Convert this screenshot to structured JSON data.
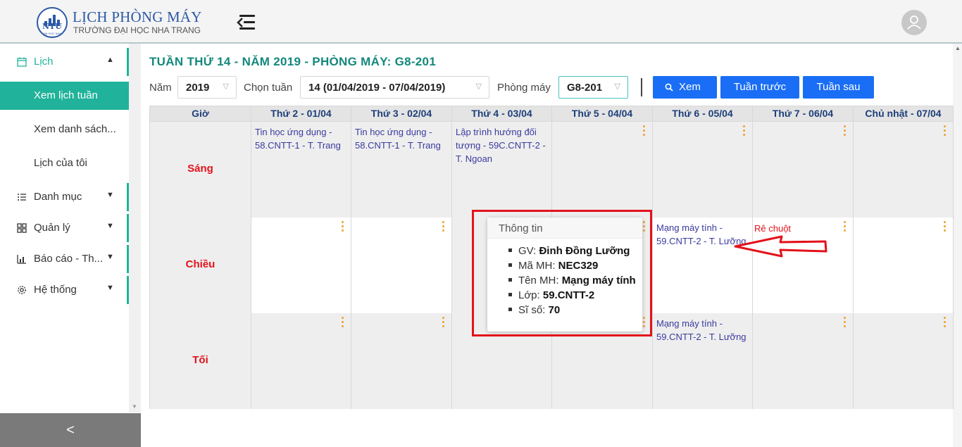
{
  "brand": {
    "title": "LỊCH PHÒNG MÁY",
    "subtitle": "TRƯỜNG ĐẠI HỌC NHA TRANG",
    "logo_text": "NTU",
    "logo_ring": "ĐẠI HỌC NHA TRANG",
    "color": "#2b59a6"
  },
  "sidebar": {
    "calendar": {
      "label": "Lịch",
      "icon": "calendar-icon",
      "chevron": "▲"
    },
    "active_item": "Xem lịch tuần",
    "sub_items": [
      "Xem danh sách...",
      "Lịch của tôi"
    ],
    "groups": [
      {
        "label": "Danh mục",
        "icon": "list-icon",
        "chevron": "▼"
      },
      {
        "label": "Quản lý",
        "icon": "grid-icon",
        "chevron": "▼"
      },
      {
        "label": "Báo cáo - Th...",
        "icon": "bar-chart-icon",
        "chevron": "▼"
      },
      {
        "label": "Hệ thống",
        "icon": "gear-icon",
        "chevron": "▼"
      }
    ],
    "collapse_label": "<",
    "accent": "#20b29a"
  },
  "page": {
    "title": "TUẦN THỨ 14 - NĂM 2019 - PHÒNG MÁY: G8-201",
    "title_color": "#13887c"
  },
  "filters": {
    "year_label": "Năm",
    "year_value": "2019",
    "week_label": "Chọn tuần",
    "week_value": "14 (01/04/2019 - 07/04/2019)",
    "room_label": "Phòng máy",
    "room_value": "G8-201",
    "caret": "▽"
  },
  "buttons": {
    "view": "Xem",
    "prev_week": "Tuần trước",
    "next_week": "Tuần sau",
    "color": "#1a6ef5"
  },
  "table": {
    "headers": [
      "Giờ",
      "Thứ 2 - 01/04",
      "Thứ 3 - 02/04",
      "Thứ 4 - 03/04",
      "Thứ 5 - 04/04",
      "Thứ 6 - 05/04",
      "Thứ 7 - 06/04",
      "Chủ nhật - 07/04"
    ],
    "sessions": [
      "Sáng",
      "Chiều",
      "Tối"
    ],
    "cells": {
      "morning_mon": "Tin học ứng dụng - 58.CNTT-1 - T. Trang",
      "morning_tue": "Tin học ứng dụng - 58.CNTT-1 - T. Trang",
      "morning_wed": "Lập trình hướng đối tượng - 59C.CNTT-2 - T. Ngoan",
      "afternoon_fri": "Mạng máy tính - 59.CNTT-2 - T. Lưỡng",
      "evening_fri": "Mạng máy tính - 59.CNTT-2 - T. Lưỡng"
    },
    "hover_note": "Rê chuột"
  },
  "popover": {
    "title": "Thông tin",
    "items": [
      {
        "label": "GV:",
        "value": "Đinh Đồng Lưỡng"
      },
      {
        "label": "Mã MH:",
        "value": "NEC329"
      },
      {
        "label": "Tên MH:",
        "value": "Mạng máy tính"
      },
      {
        "label": "Lớp:",
        "value": "59.CNTT-2"
      },
      {
        "label": "Sĩ số:",
        "value": "70"
      }
    ]
  },
  "annotation_color": "#e3121b"
}
